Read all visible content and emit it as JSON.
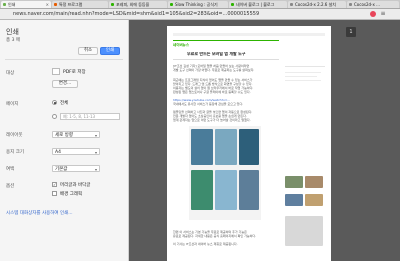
{
  "tabs": [
    {
      "label": "인쇄",
      "fav": "#6ab04c"
    },
    {
      "label": "특정 프로그램",
      "fav": "#e65c00"
    },
    {
      "label": "포레피, 외에 등등을",
      "fav": "#2db400"
    },
    {
      "label": "Slow Thinking : 공식기",
      "fav": "#2db400"
    },
    {
      "label": "네이버 블로그 | 블로그",
      "fav": "#2db400"
    },
    {
      "label": "Cocos2d-x 2.2.6 설치",
      "fav": "#888888"
    },
    {
      "label": "Cocos2d-x ...",
      "fav": "#888888"
    }
  ],
  "address": {
    "url": "news.naver.com/main/read.nhn?mode=LSD&mid=shm&sid1=105&sid2=283&oid=...0000015559"
  },
  "panel": {
    "title": "인쇄",
    "sheet_count": "총 3 매",
    "print_button": "인쇄",
    "cancel_button": "취소",
    "dest_label": "대상",
    "dest_value": "PDF로 저장",
    "change_button": "변경...",
    "pages_label": "페이지",
    "pages_all": "전체",
    "pages_placeholder": "예: 1-5, 8, 11-13",
    "layout_label": "레이아웃",
    "layout_value": "세로 방향",
    "paper_label": "용지 크기",
    "paper_value": "A4",
    "margin_label": "여백",
    "margin_value": "기본값",
    "options_label": "옵션",
    "opt_header": "머리글과 바닥글",
    "opt_bg": "배경 그래픽",
    "system_link": "시스템 대화상자를 사용하여 인쇄..."
  },
  "preview": {
    "page_number": "1",
    "brand": "네이버뉴스",
    "headline": "무료로 만드는 모바일 앱 개발 도구",
    "lines": [
      "[IT조선 김성 기자] 모바일 앱을 처음 만들어 보는 사람이라면",
      "개발 도구 선택이 가장 어렵다. 무료로 제공되는 도구를 살펴보자.",
      "최근에는 프로그래밍 지식이 없어도 앱을 만들 수 있는 서비스가",
      "많아지고 있다. 드래그 앤 드롭 방식으로 화면을 구성할 수 있다.",
      "이용자는 별도의 설치 없이 웹 브라우저에서 바로 작업 가능하다.",
      "완성된 앱은 앱스토어나 구글 플레이에 바로 등록할 수도 있다.",
      "https://www.youtube.com/watch?v=...",
      "국내에서도 유사한 서비스가 등장해 관심을 모으고 있다.",
      "템플릿을 선택하고 사진과 글을 넣으면 앱이 자동으로 완성된다.",
      "전문 개발자 없이도 소상공인이 홍보용 앱을 손쉽게 만든다.",
      "업계 관계자는 앞으로 이런 도구가 더 늘어날 것이라고 말했다."
    ],
    "lines2": [
      "한편 이 서비스는 기본 기능을 무료로 제공하며 추가 기능은",
      "유료로 제공된다. 자세한 내용은 공식 홈페이지에서 확인 가능하다.",
      "이 기사는 IT조선과 네이버 뉴스 제휴로 제공됩니다."
    ]
  }
}
